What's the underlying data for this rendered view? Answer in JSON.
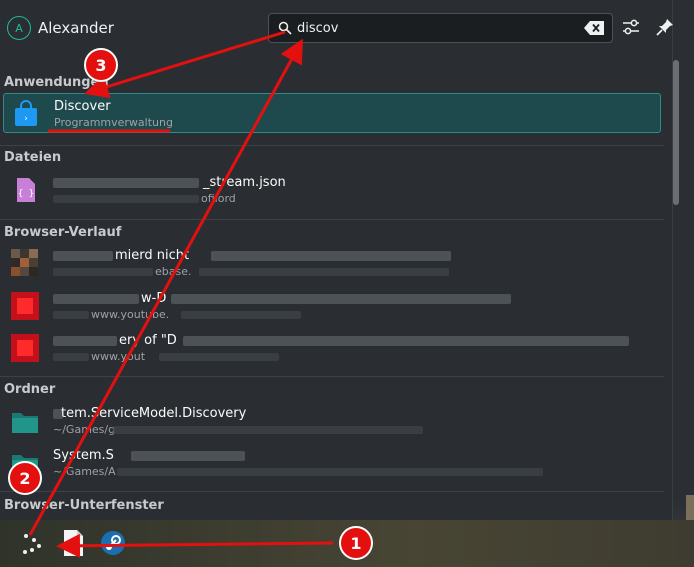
{
  "header": {
    "avatar_letter": "A",
    "username": "Alexander",
    "search_value": "discov"
  },
  "sections": {
    "applications": "Anwendungen",
    "files": "Dateien",
    "browser_history": "Browser-Verlauf",
    "folders": "Ordner",
    "browser_tabs": "Browser-Unterfenster"
  },
  "app_result": {
    "title": "Discover",
    "subtitle": "Programmverwaltung"
  },
  "file_result": {
    "title_fragment": "_stream.json",
    "subtitle_fragment": "ofilord"
  },
  "history_results": [
    {
      "title_fragment": "mierd nicht",
      "subtitle_fragment": "ebase."
    },
    {
      "title_fragment": "w-D",
      "subtitle_fragment": "www.youtube."
    },
    {
      "title_fragment": "ery of \"D",
      "subtitle_fragment": "www.yout"
    }
  ],
  "folder_results": [
    {
      "title_fragment": "tem.ServiceModel.Discovery",
      "subtitle_fragment": "~/Games/g"
    },
    {
      "title_fragment": "System.S",
      "subtitle_fragment": "~/Games/A"
    }
  ],
  "annotations": {
    "badge1": "1",
    "badge2": "2",
    "badge3": "3"
  },
  "colors": {
    "accent": "#1abc9c",
    "selection": "#1e4a4e",
    "annotation_red": "#e3100f"
  },
  "icons": {
    "search": "search-icon",
    "clear": "backspace-icon",
    "config": "sliders-icon",
    "pin": "pin-icon",
    "app_discover": "shopping-bag-icon",
    "launcher": "launcher-icon",
    "taskbar_file": "document-icon",
    "taskbar_steam": "steam-icon"
  }
}
